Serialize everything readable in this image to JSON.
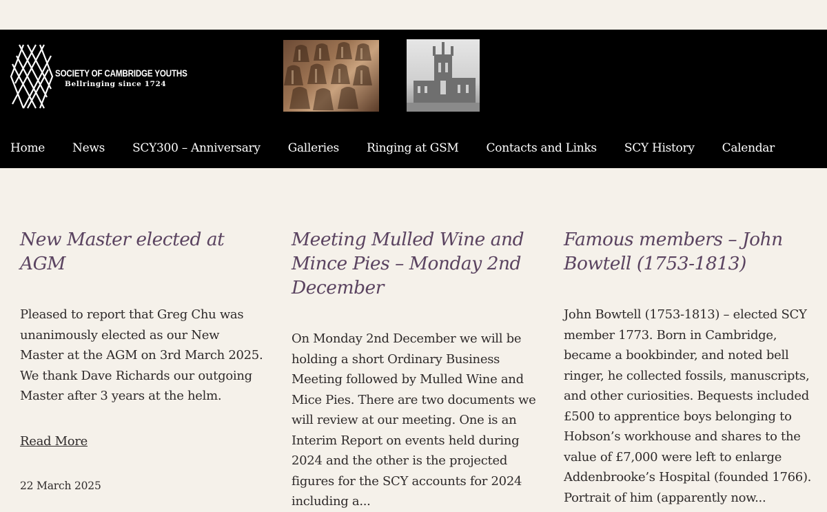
{
  "site": {
    "logo_title": "SOCIETY OF CAMBRIDGE YOUTHS",
    "logo_subtitle": "Bellringing since 1724"
  },
  "nav": {
    "items": [
      {
        "label": "Home"
      },
      {
        "label": "News"
      },
      {
        "label": "SCY300 – Anniversary"
      },
      {
        "label": "Galleries"
      },
      {
        "label": "Ringing at GSM"
      },
      {
        "label": "Contacts and Links"
      },
      {
        "label": "SCY History"
      },
      {
        "label": "Calendar"
      }
    ]
  },
  "posts": [
    {
      "title": "New Master elected at AGM",
      "excerpt": "Pleased to report that Greg Chu was unanimously elected as our New Master at the AGM on 3rd March 2025. We thank Dave Richards our outgoing Master after 3 years at the helm.",
      "read_more": "Read More",
      "date": "22 March 2025"
    },
    {
      "title": "Meeting Mulled Wine and Mince Pies – Monday 2nd December",
      "excerpt": "On Monday 2nd December we will be holding a short Ordinary Business Meeting followed by Mulled Wine and Mice Pies. There are two documents we will review at our meeting. One is an Interim Report on events held during 2024 and the other is the projected figures for the SCY accounts for 2024 including a..."
    },
    {
      "title": "Famous members – John Bowtell (1753-1813)",
      "excerpt": "John Bowtell (1753-1813) – elected SCY member 1773. Born in Cambridge, became a bookbinder, and noted bell ringer, he collected fossils, manuscripts, and other curiosities. Bequests included £500 to apprentice boys belonging to Hobson’s workhouse and shares to the value of £7,000 were left to enlarge Addenbrooke’s Hospital (founded 1766). Portrait of him (apparently now..."
    }
  ],
  "colors": {
    "background": "#f5f1ea",
    "header": "#000000",
    "title": "#5a4360",
    "text": "#2e2a2a"
  }
}
